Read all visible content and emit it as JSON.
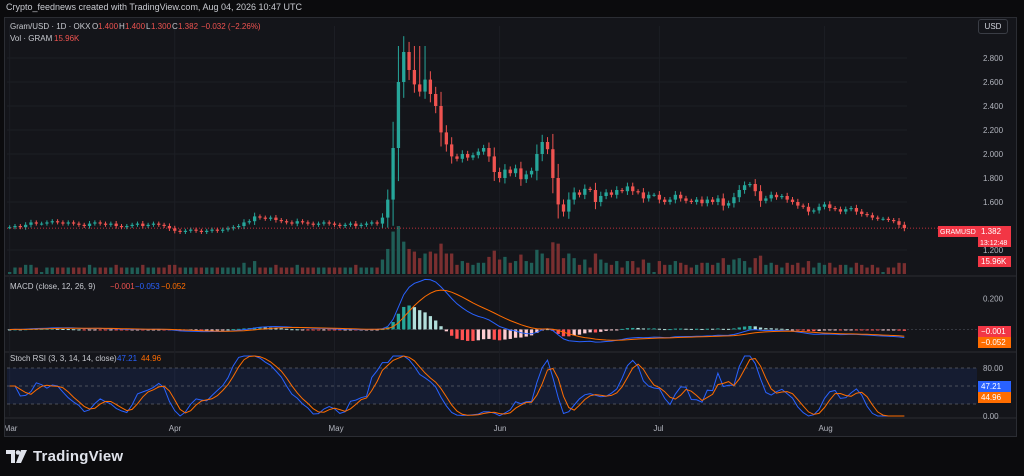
{
  "caption": "Crypto_feednews created with TradingView.com, Aug 04, 2026 10:47 UTC",
  "currency_button": "USD",
  "brand": "TradingView",
  "colors": {
    "up": "#26a69a",
    "down": "#ef5350",
    "macd": "#2962ff",
    "signal": "#ff6d00",
    "k": "#2962ff",
    "d": "#ff6d00",
    "vol_up": "#1f5e57",
    "vol_down": "#7a2f30"
  },
  "main_pane": {
    "legend": {
      "symbol": "Gram/USD · 1D · OKX",
      "o_label": "O",
      "o_value": "1.400",
      "h_label": "H",
      "h_value": "1.400",
      "l_label": "L",
      "l_value": "1.300",
      "c_label": "C",
      "c_value": "1.382",
      "change": "−0.032 (−2.26%)"
    },
    "vol_legend": {
      "label": "Vol · GRAM",
      "value": "15.96K"
    },
    "last_price_label": "GRAMUSD",
    "last_price": "1.382",
    "countdown": "13:12:48",
    "volume_tag": "15.96K"
  },
  "macd_pane": {
    "title": "MACD (close, 12, 26, 9)",
    "hist_value": "−0.001",
    "macd_value": "−0.053",
    "signal_value": "−0.052",
    "tag_a": "−0.001",
    "tag_b": "−0.052",
    "ticks": [
      "0.200"
    ]
  },
  "rsi_pane": {
    "title": "Stoch RSI (3, 3, 14, 14, close)",
    "k_value": "47.21",
    "d_value": "44.96",
    "tag_k": "47.21",
    "tag_d": "44.96",
    "ticks": [
      "80.00",
      "0.00"
    ]
  },
  "chart_data": {
    "type": "candlestick",
    "y_ticks": [
      "2.800",
      "2.600",
      "2.400",
      "2.200",
      "2.000",
      "1.800",
      "1.600",
      "1.200"
    ],
    "ylim": [
      1.2,
      2.9
    ],
    "x_ticks": [
      "Mar",
      "Apr",
      "May",
      "Jun",
      "Jul",
      "Aug"
    ],
    "close_series": [
      1.39,
      1.4,
      1.39,
      1.41,
      1.43,
      1.42,
      1.42,
      1.43,
      1.44,
      1.43,
      1.42,
      1.43,
      1.42,
      1.41,
      1.4,
      1.42,
      1.43,
      1.42,
      1.41,
      1.42,
      1.4,
      1.39,
      1.4,
      1.41,
      1.42,
      1.4,
      1.41,
      1.42,
      1.41,
      1.4,
      1.38,
      1.36,
      1.35,
      1.36,
      1.37,
      1.36,
      1.35,
      1.36,
      1.37,
      1.36,
      1.37,
      1.38,
      1.39,
      1.4,
      1.43,
      1.44,
      1.48,
      1.47,
      1.46,
      1.47,
      1.45,
      1.44,
      1.43,
      1.42,
      1.44,
      1.43,
      1.42,
      1.41,
      1.42,
      1.43,
      1.42,
      1.41,
      1.4,
      1.41,
      1.42,
      1.4,
      1.41,
      1.42,
      1.43,
      1.42,
      1.47,
      1.62,
      2.05,
      2.6,
      2.85,
      2.7,
      2.58,
      2.52,
      2.62,
      2.5,
      2.4,
      2.18,
      2.08,
      1.98,
      1.96,
      2.0,
      1.97,
      1.99,
      2.02,
      2.05,
      1.98,
      1.85,
      1.8,
      1.87,
      1.84,
      1.88,
      1.79,
      1.83,
      1.86,
      2.0,
      2.1,
      2.04,
      1.8,
      1.58,
      1.52,
      1.62,
      1.68,
      1.66,
      1.71,
      1.7,
      1.6,
      1.65,
      1.68,
      1.66,
      1.7,
      1.69,
      1.73,
      1.69,
      1.68,
      1.63,
      1.66,
      1.66,
      1.62,
      1.6,
      1.62,
      1.66,
      1.63,
      1.61,
      1.6,
      1.62,
      1.59,
      1.62,
      1.6,
      1.63,
      1.57,
      1.59,
      1.64,
      1.7,
      1.74,
      1.75,
      1.69,
      1.61,
      1.63,
      1.66,
      1.64,
      1.65,
      1.62,
      1.6,
      1.57,
      1.56,
      1.52,
      1.53,
      1.56,
      1.58,
      1.55,
      1.54,
      1.52,
      1.54,
      1.55,
      1.52,
      1.5,
      1.49,
      1.47,
      1.46,
      1.46,
      1.45,
      1.44,
      1.41,
      1.382
    ],
    "series_scales": {
      "macd_ylim": [
        -0.12,
        0.32
      ],
      "stoch_ylim": [
        0,
        100
      ]
    }
  }
}
